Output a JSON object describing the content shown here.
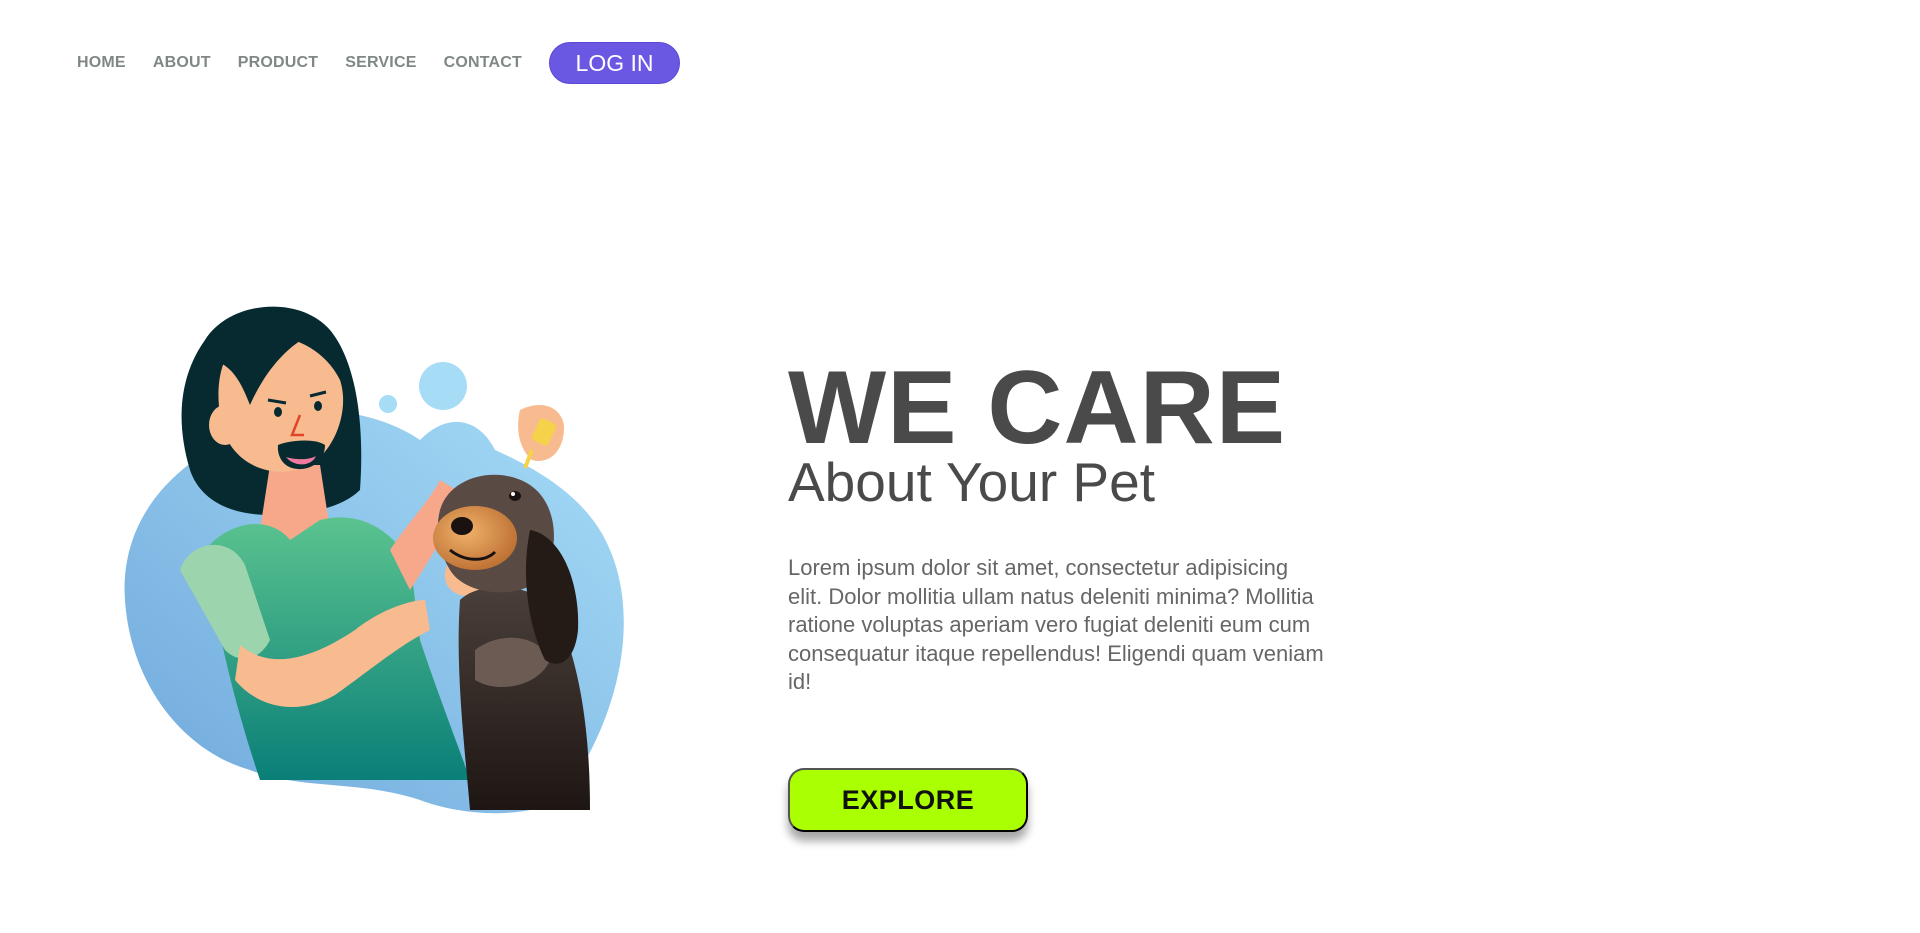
{
  "nav": {
    "links": [
      "HOME",
      "ABOUT",
      "PRODUCT",
      "SERVICE",
      "CONTACT"
    ],
    "login_label": "LOG IN"
  },
  "hero": {
    "title": "WE CARE",
    "subtitle": "About Your Pet",
    "body": "Lorem ipsum dolor sit amet, consectetur adipisicing elit. Dolor mollitia ullam natus deleniti minima? Mollitia ratione voluptas aperiam vero fugiat deleniti eum cum consequatur itaque repellendus! Eligendi quam veniam id!",
    "explore_label": "EXPLORE"
  },
  "colors": {
    "login_button": "#6a58e3",
    "explore_button": "#aaff00",
    "heading_text": "#4a4a4a",
    "nav_text": "#808884"
  }
}
